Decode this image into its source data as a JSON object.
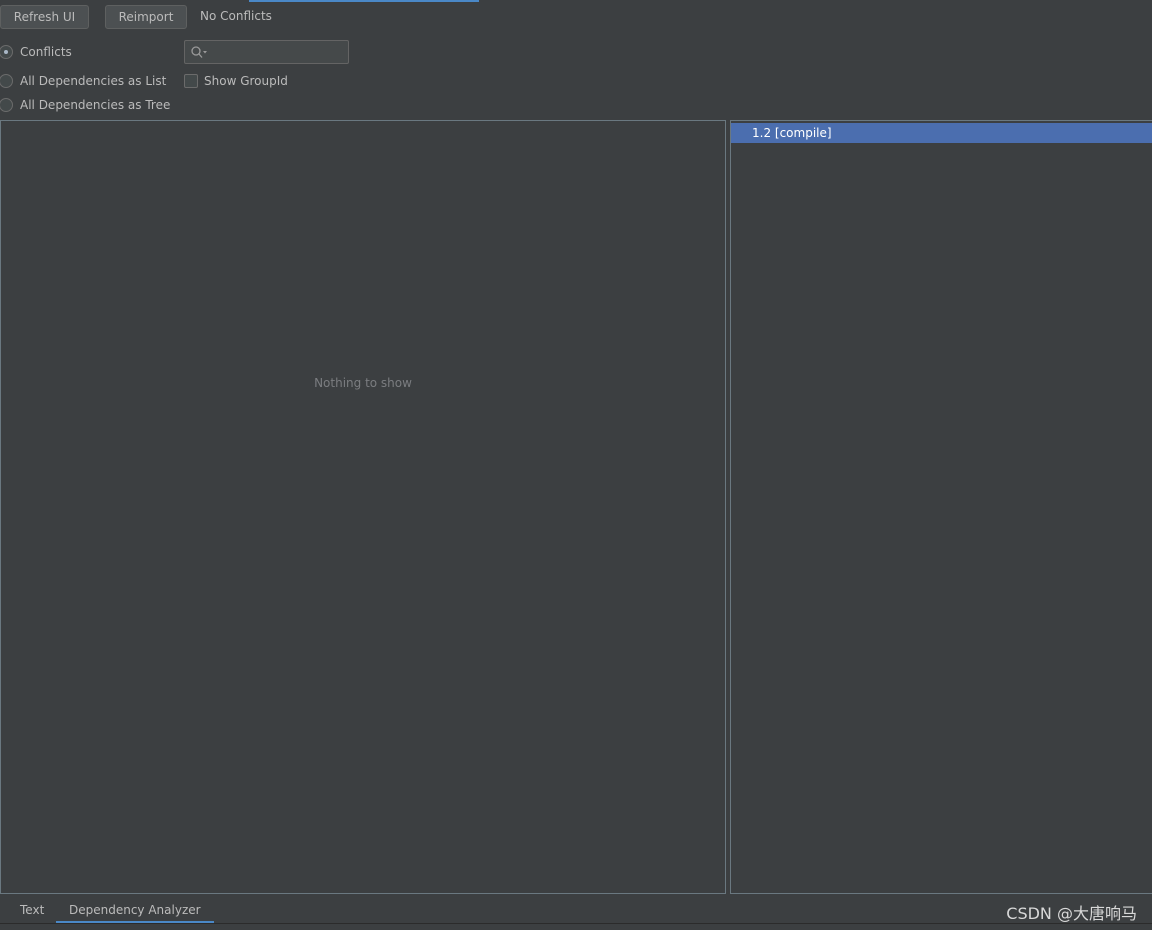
{
  "toolbar": {
    "refresh_label": "Refresh UI",
    "reimport_label": "Reimport",
    "status": "No Conflicts"
  },
  "view_options": [
    {
      "label": "Conflicts",
      "selected": true
    },
    {
      "label": "All Dependencies as List",
      "selected": false
    },
    {
      "label": "All Dependencies as Tree",
      "selected": false
    }
  ],
  "search": {
    "value": "",
    "placeholder": ""
  },
  "show_group_id": {
    "label": "Show GroupId",
    "checked": false
  },
  "left_pane": {
    "empty_text": "Nothing to show"
  },
  "right_pane": {
    "items": [
      {
        "label": "1.2 [compile]",
        "selected": true
      }
    ]
  },
  "bottom_tabs": [
    {
      "label": "Text",
      "active": false
    },
    {
      "label": "Dependency Analyzer",
      "active": true
    }
  ],
  "watermark": "CSDN @大唐响马",
  "colors": {
    "background": "#3c3f41",
    "selection": "#4b6eaf",
    "accent": "#4a88c7"
  }
}
